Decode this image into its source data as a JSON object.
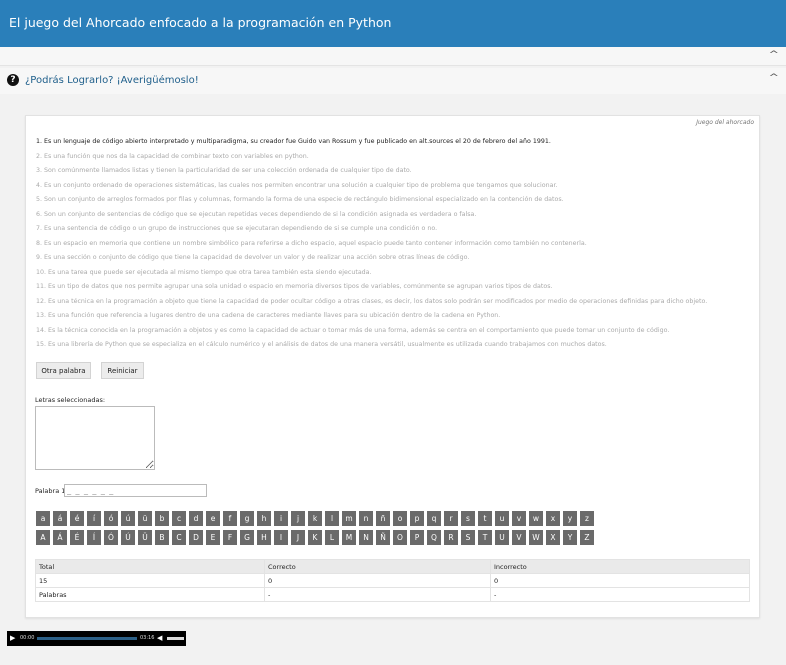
{
  "header": {
    "title": "El juego del Ahorcado enfocado a la programación en Python"
  },
  "activity": {
    "title": "¿Podrás Lograrlo? ¡Averigüémoslo!",
    "game_label": "Juego del ahorcado"
  },
  "clues": [
    "1. Es un lenguaje de código abierto interpretado y multiparadigma, su creador fue Guido van Rossum y fue publicado en alt.sources el 20 de febrero del año 1991.",
    "2. Es una función que nos da la capacidad de combinar texto con variables en python.",
    "3. Son comúnmente llamados listas y tienen la particularidad de ser una colección ordenada de cualquier tipo de dato.",
    "4. Es un conjunto ordenado de operaciones sistemáticas, las cuales nos permiten encontrar una solución a cualquier tipo de problema que tengamos que solucionar.",
    "5. Son un conjunto de arreglos formados por filas y columnas, formando la forma de una especie de rectángulo bidimensional especializado en la contención de datos.",
    "6. Son un conjunto de sentencias de código que se ejecutan repetidas veces dependiendo de si la condición asignada es verdadera o falsa.",
    "7. Es una sentencia de código o un grupo de instrucciones que se ejecutaran dependiendo de si se cumple una condición o no.",
    "8. Es un espacio en memoria que contiene un nombre simbólico para referirse a dicho espacio, aquel espacio puede tanto contener información como también no contenerla.",
    "9. Es una sección o conjunto de código que tiene la capacidad de devolver un valor y de realizar una acción sobre otras líneas de código.",
    "10. Es una tarea que puede ser ejecutada al mismo tiempo que otra tarea también esta siendo ejecutada.",
    "11. Es un tipo de datos que nos permite agrupar una sola unidad o espacio en memoria diversos tipos de variables, comúnmente se agrupan varios tipos de datos.",
    "12. Es una técnica en la programación a objeto que tiene la capacidad de poder ocultar código a otras clases, es decir, los datos solo podrán ser modificados por medio de operaciones definidas para dicho objeto.",
    "13. Es una función que referencia a lugares dentro de una cadena de caracteres mediante llaves para su ubicación dentro de la cadena en Python.",
    "14. Es la técnica conocida en la programación a objetos y es como la capacidad de actuar o tomar más de una forma, además se centra en el comportamiento que puede tomar un conjunto de código.",
    "15. Es una librería de Python que se especializa en el cálculo numérico y el análisis de datos de una manera versátil, usualmente es utilizada cuando trabajamos con muchos datos."
  ],
  "buttons": {
    "other_word": "Otra palabra",
    "reset": "Reiniciar"
  },
  "selected_letters": {
    "label": "Letras seleccionadas:",
    "value": ""
  },
  "word": {
    "label": "Palabra 1:",
    "value": "_ _ _ _ _ _"
  },
  "keyboard": {
    "lowercase": [
      "a",
      "á",
      "é",
      "í",
      "ó",
      "ú",
      "ü",
      "b",
      "c",
      "d",
      "e",
      "f",
      "g",
      "h",
      "i",
      "j",
      "k",
      "l",
      "m",
      "n",
      "ñ",
      "o",
      "p",
      "q",
      "r",
      "s",
      "t",
      "u",
      "v",
      "w",
      "x",
      "y",
      "z"
    ],
    "uppercase": [
      "A",
      "Á",
      "É",
      "Í",
      "Ó",
      "Ú",
      "Ü",
      "B",
      "C",
      "D",
      "E",
      "F",
      "G",
      "H",
      "I",
      "J",
      "K",
      "L",
      "M",
      "N",
      "Ñ",
      "O",
      "P",
      "Q",
      "R",
      "S",
      "T",
      "U",
      "V",
      "W",
      "X",
      "Y",
      "Z"
    ]
  },
  "stats": {
    "headers": [
      "Total",
      "Correcto",
      "Incorrecto"
    ],
    "row1": [
      "15",
      "0",
      "0"
    ],
    "row2": [
      "Palabras",
      "-",
      "-"
    ]
  },
  "player": {
    "current_time": "00:00",
    "duration": "03:16",
    "progress": 0,
    "volume": 1.0
  },
  "colors": {
    "header": "#2a7fba",
    "key": "#6a6a6a",
    "title_link": "#1f5f8b"
  },
  "icons": {
    "collapse": "chevron-up-icon",
    "question": "question-circle-icon",
    "play": "play-icon",
    "volume": "volume-icon"
  }
}
